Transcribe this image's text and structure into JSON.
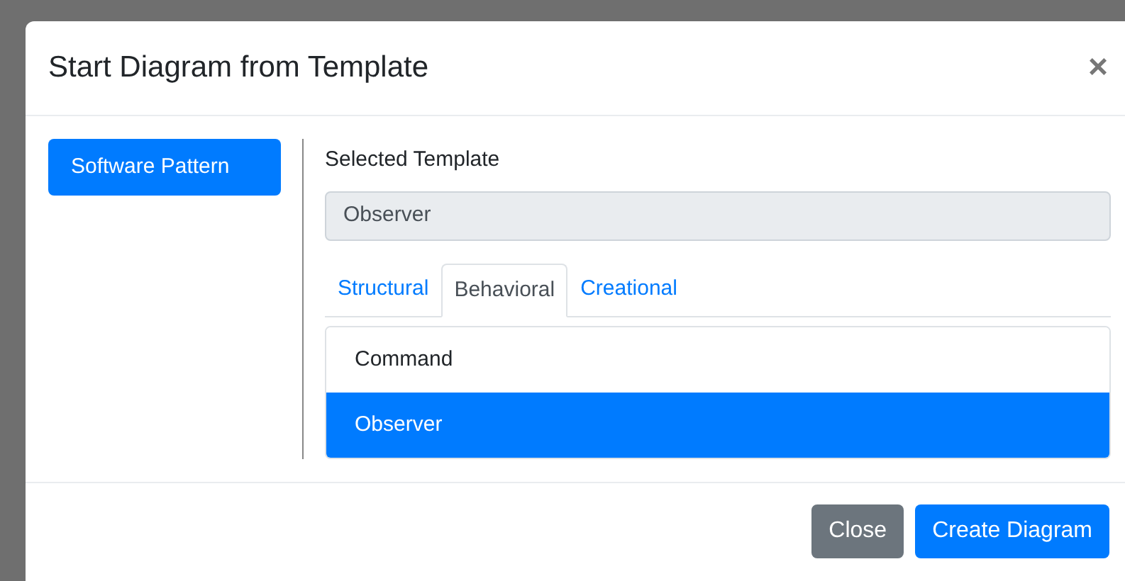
{
  "dialog": {
    "title": "Start Diagram from Template",
    "close_icon": "×"
  },
  "sidebar": {
    "items": [
      {
        "label": "Software Pattern",
        "selected": true
      }
    ]
  },
  "selected_template": {
    "label": "Selected Template",
    "value": "Observer"
  },
  "tabs": [
    {
      "label": "Structural",
      "selected": false
    },
    {
      "label": "Behavioral",
      "selected": true
    },
    {
      "label": "Creational",
      "selected": false
    }
  ],
  "templates": [
    {
      "label": "Command",
      "selected": false
    },
    {
      "label": "Observer",
      "selected": true
    }
  ],
  "buttons": [
    {
      "label": "Close",
      "kind": "secondary"
    },
    {
      "label": "Create Diagram",
      "kind": "primary"
    }
  ]
}
